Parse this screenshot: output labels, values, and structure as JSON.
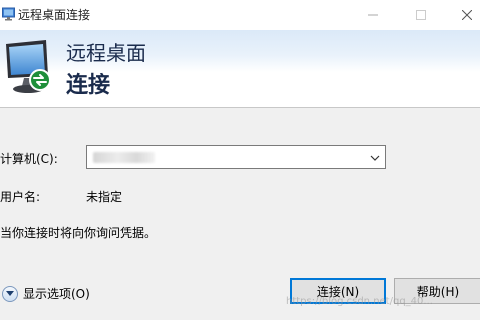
{
  "window": {
    "title": "远程桌面连接",
    "minimize_icon": "minimize-icon",
    "maximize_icon": "maximize-icon",
    "close_icon": "close-icon"
  },
  "banner": {
    "line1": "远程桌面",
    "line2": "连接",
    "icon": "remote-desktop-monitor-icon"
  },
  "form": {
    "computer_label": "计算机(C):",
    "computer_value": "",
    "user_label": "用户名:",
    "user_value": "未指定",
    "credentials_note": "当你连接时将向你询问凭据。"
  },
  "options": {
    "label": "显示选项(O)",
    "icon": "chevron-down-circle-icon"
  },
  "buttons": {
    "connect": "连接(N)",
    "help": "帮助(H)"
  },
  "watermark": "https://blog.csdn.net/qq_40..."
}
